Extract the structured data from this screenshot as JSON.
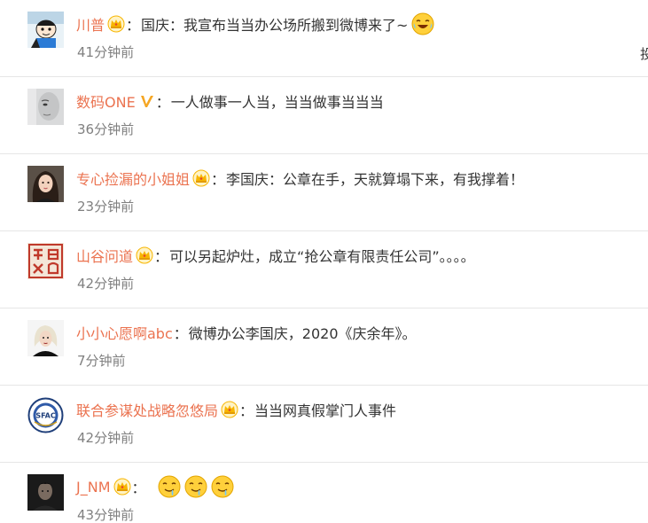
{
  "comments": [
    {
      "username": "川普",
      "avatar": "cartoon-avatar",
      "badge": "crown-icon",
      "separator": "：",
      "text": "国庆：我宣布当当办公场所搬到微博来了~",
      "emoji": "laughing-tears-emoji",
      "time": "41分钟前",
      "action_partial": "投"
    },
    {
      "username": "数码ONE",
      "avatar": "face-avatar",
      "badge": "verified-v-icon",
      "separator": "：",
      "text": "一人做事一人当，当当做事当当当",
      "time": "36分钟前"
    },
    {
      "username": "专心捡漏的小姐姐",
      "avatar": "girl-photo-avatar",
      "badge": "crown-icon",
      "separator": "：",
      "text": "李国庆：公章在手，天就算塌下来，有我撑着！",
      "time": "23分钟前"
    },
    {
      "username": "山谷问道",
      "avatar": "seal-avatar",
      "badge": "crown-icon",
      "separator": "：",
      "text": "可以另起炉灶，成立“抢公章有限责任公司”。。。。",
      "time": "42分钟前"
    },
    {
      "username": "小小心愿啊abc",
      "avatar": "blonde-avatar",
      "separator": " ：",
      "text": "微博办公李国庆，2020《庆余年》。",
      "time": "7分钟前"
    },
    {
      "username": "联合参谋处战略忽悠局",
      "avatar": "sfac-emblem-avatar",
      "avatar_text": "SFAC",
      "badge": "crown-icon",
      "separator": "：",
      "text": "当当网真假掌门人事件",
      "time": "42分钟前"
    },
    {
      "username": "J_NM",
      "avatar": "dark-photo-avatar",
      "badge": "crown-icon",
      "separator": "：",
      "emojis": [
        "drooling-emoji",
        "drooling-emoji",
        "drooling-emoji"
      ],
      "time": "43分钟前"
    }
  ],
  "colors": {
    "username": "#eb7350",
    "text": "#333333",
    "time": "#808080",
    "divider": "#e6e6e6",
    "crown": "#f7b500",
    "crown_gem": "#e8412c",
    "verified": "#f5a623"
  }
}
